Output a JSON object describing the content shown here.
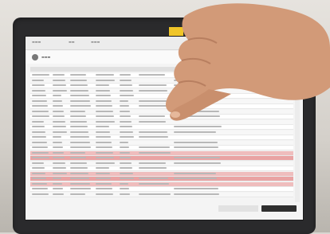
{
  "scene": {
    "subject": "finger-pointing-at-tablet-screen",
    "screen_content": "data-table-with-highlighted-rows",
    "tape_color": "#f0c528",
    "highlight_color": "#e9a3a3",
    "text_legible": false
  }
}
